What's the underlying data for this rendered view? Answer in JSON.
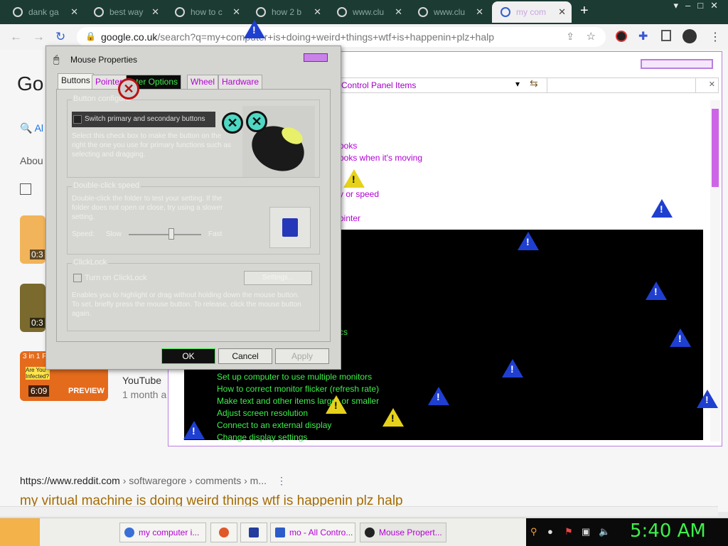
{
  "browser": {
    "tabs": [
      {
        "title": "dank ga"
      },
      {
        "title": "best way"
      },
      {
        "title": "how to c"
      },
      {
        "title": "how 2 b"
      },
      {
        "title": "www.clu"
      },
      {
        "title": "www.clu"
      },
      {
        "title": "my com",
        "active": true
      }
    ],
    "new_tab": "+",
    "url_host": "google.co.uk",
    "url_path": "/search?q=my+computer+is+doing+weird+things+wtf+is+happenin+plz+halp"
  },
  "google": {
    "logo_partial": "Go",
    "tab_all": "Al",
    "about_partial": "Abou",
    "video_durations": [
      "0:3",
      "0:3"
    ],
    "video_thumb": {
      "duration": "6:09",
      "preview": "PREVIEW",
      "text": "Are You Infected?",
      "banner": "3 in 1 Fr"
    },
    "youtube_source": "YouTube",
    "youtube_age": "1 month a",
    "reddit_url": "https://www.reddit.com",
    "reddit_path": " › softwaregore › comments › m...",
    "result_title": "my virtual machine is doing weird things wtf is happenin plz halp"
  },
  "control_panel": {
    "address": "Control Panel Items",
    "links": [
      "ooks",
      "ooks when it's moving",
      "y or speed",
      "ointer"
    ],
    "green_links": [
      "cs",
      "Set up computer to use multiple monitors",
      "How to correct monitor flicker (refresh rate)",
      "Make text and other items larger or smaller",
      "Adjust screen resolution",
      "Connect to an external display",
      "Change display settings"
    ]
  },
  "mouse_dialog": {
    "title": "Mouse Properties",
    "tabs": [
      "Buttons",
      "Pointers",
      "Pointer Options",
      "Wheel",
      "Hardware"
    ],
    "tab_labels_shown": [
      "Buttons",
      "Pointers",
      "inter Options",
      "Wheel",
      "Hardware"
    ],
    "button_config": {
      "label": "Button configura",
      "checkbox_label": "Switch primary and secondary buttons",
      "description": "Select this check box to make the button on the right the one you use for primary functions such as selecting and dragging."
    },
    "double_click": {
      "label": "Double-click speed",
      "description": "Double-click the folder to test your setting. If the folder does not open or close, try using a slower setting.",
      "speed_label": "Speed:",
      "slow": "Slow",
      "fast": "Fast",
      "speed_value": 0.6
    },
    "clicklock": {
      "label": "ClickLock",
      "checkbox_label": "Turn on ClickLock",
      "settings_button": "Settings...",
      "description": "Enables you to highlight or drag without holding down the mouse button. To set, briefly press the mouse button. To release, click the mouse button again."
    },
    "buttons": {
      "ok": "OK",
      "cancel": "Cancel",
      "apply": "Apply"
    }
  },
  "taskbar": {
    "items": [
      {
        "label": "my computer i..."
      },
      {
        "label": ""
      },
      {
        "label": ""
      },
      {
        "label": "mo - All Contro..."
      },
      {
        "label": "Mouse Propert..."
      }
    ],
    "clock": "5:40 AM"
  },
  "colors": {
    "accent_purple": "#b300d6",
    "glitch_green": "#3cf04a",
    "warning_blue": "#1f3fd0",
    "warning_yellow": "#e6d21a"
  }
}
